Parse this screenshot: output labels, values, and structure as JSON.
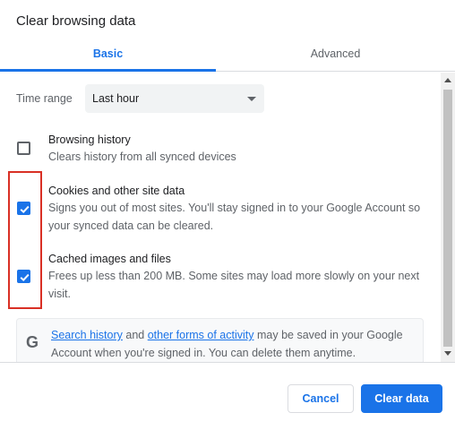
{
  "dialog": {
    "title": "Clear browsing data"
  },
  "tabs": [
    {
      "label": "Basic",
      "selected": true
    },
    {
      "label": "Advanced",
      "selected": false
    }
  ],
  "time_range": {
    "label": "Time range",
    "value": "Last hour"
  },
  "options": [
    {
      "title": "Browsing history",
      "description": "Clears history from all synced devices",
      "checked": false
    },
    {
      "title": "Cookies and other site data",
      "description": "Signs you out of most sites. You'll stay signed in to your Google Account so your synced data can be cleared.",
      "checked": true
    },
    {
      "title": "Cached images and files",
      "description": "Frees up less than 200 MB. Some sites may load more slowly on your next visit.",
      "checked": true
    }
  ],
  "info": {
    "icon": "google-g-icon",
    "link1": "Search history",
    "text1": " and ",
    "link2": "other forms of activity",
    "text2": " may be saved in your Google Account when you're signed in. You can delete them anytime."
  },
  "buttons": {
    "cancel": "Cancel",
    "clear": "Clear data"
  },
  "colors": {
    "accent": "#1a73e8",
    "highlight": "#d93025"
  }
}
